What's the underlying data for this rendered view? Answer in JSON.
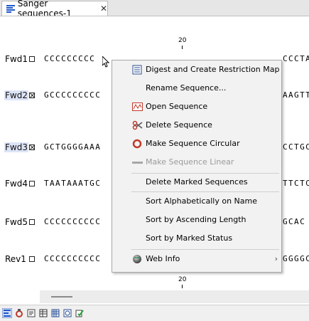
{
  "tab": {
    "title": "Sanger sequences-1",
    "close": "✕",
    "icon": "sequence-list-icon"
  },
  "ruler": {
    "position_label": "20"
  },
  "rows": [
    {
      "name": "Fwd1",
      "seq": "CCCCCCCCC",
      "tail": "CCCTA",
      "marked": false,
      "selected": false
    },
    {
      "name": "Fwd2",
      "seq": "GCCCCCCCCC",
      "tail": "AAGTT",
      "marked": true,
      "selected": true
    },
    {
      "name": "Fwd3",
      "seq": "GCTGGGGAAA",
      "tail": "CCTGC",
      "marked": true,
      "selected": true
    },
    {
      "name": "Fwd4",
      "seq": "TAATAAATGC",
      "tail": "TTCTC",
      "marked": false,
      "selected": false
    },
    {
      "name": "Fwd5",
      "seq": "CCCCCCCCCC",
      "tail": "GCAC",
      "marked": false,
      "selected": false
    },
    {
      "name": "Rev1",
      "seq": "CCCCCCCCCC",
      "tail": "GGGGC",
      "marked": false,
      "selected": false
    }
  ],
  "context_menu": {
    "items": [
      {
        "label": "Digest and Create Restriction Map",
        "icon": "restriction-map-icon",
        "enabled": true
      },
      {
        "label": "Rename Sequence...",
        "icon": "",
        "enabled": true
      },
      {
        "label": "Open Sequence",
        "icon": "open-sequence-icon",
        "enabled": true
      },
      {
        "label": "Delete Sequence",
        "icon": "delete-sequence-icon",
        "enabled": true
      },
      {
        "label": "Make Sequence Circular",
        "icon": "circular-icon",
        "enabled": true
      },
      {
        "label": "Make Sequence Linear",
        "icon": "linear-icon",
        "enabled": false
      },
      {
        "label": "Delete Marked Sequences",
        "icon": "",
        "enabled": true
      },
      {
        "label": "Sort Alphabetically on Name",
        "icon": "",
        "enabled": true
      },
      {
        "label": "Sort by Ascending Length",
        "icon": "",
        "enabled": true
      },
      {
        "label": "Sort by Marked Status",
        "icon": "",
        "enabled": true
      },
      {
        "label": "Web Info",
        "icon": "globe-icon",
        "enabled": true,
        "submenu": "›"
      }
    ]
  },
  "toolbar": {
    "buttons": [
      "sequence-list-view-icon",
      "circular-view-icon",
      "text-view-icon",
      "table-view-icon",
      "grid-view-icon",
      "history-icon",
      "validate-icon"
    ]
  },
  "colors": {
    "selection": "#dde4f7",
    "accent": "#1f58c9",
    "menu_bg": "#f2f2f2"
  }
}
